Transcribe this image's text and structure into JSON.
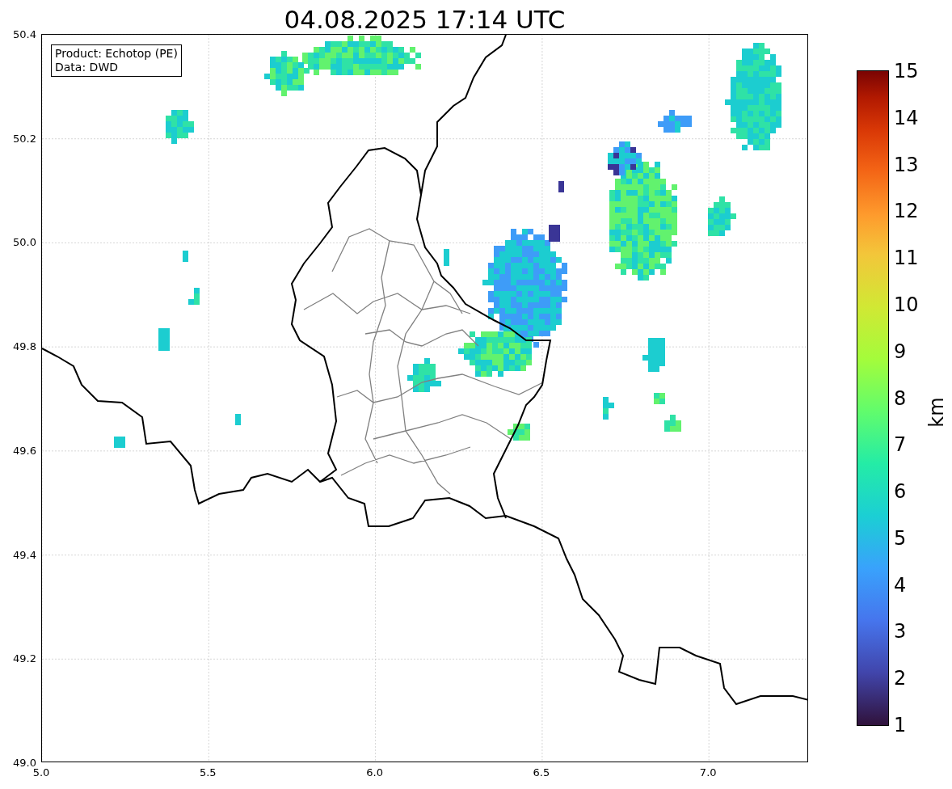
{
  "title": "04.08.2025 17:14 UTC",
  "info_box": {
    "lines": [
      "Product: Echotop (PE)",
      "Data: DWD"
    ]
  },
  "x_ticks": [
    "5.0",
    "5.5",
    "6.0",
    "6.5",
    "7.0"
  ],
  "y_ticks": [
    "50.4",
    "50.2",
    "50.0",
    "49.8",
    "49.6",
    "49.4",
    "49.2",
    "49.0"
  ],
  "colorbar": {
    "label": "km",
    "ticks": [
      "15",
      "14",
      "13",
      "12",
      "11",
      "10",
      "9",
      "8",
      "7",
      "6",
      "5",
      "4",
      "3",
      "2",
      "1"
    ]
  }
}
